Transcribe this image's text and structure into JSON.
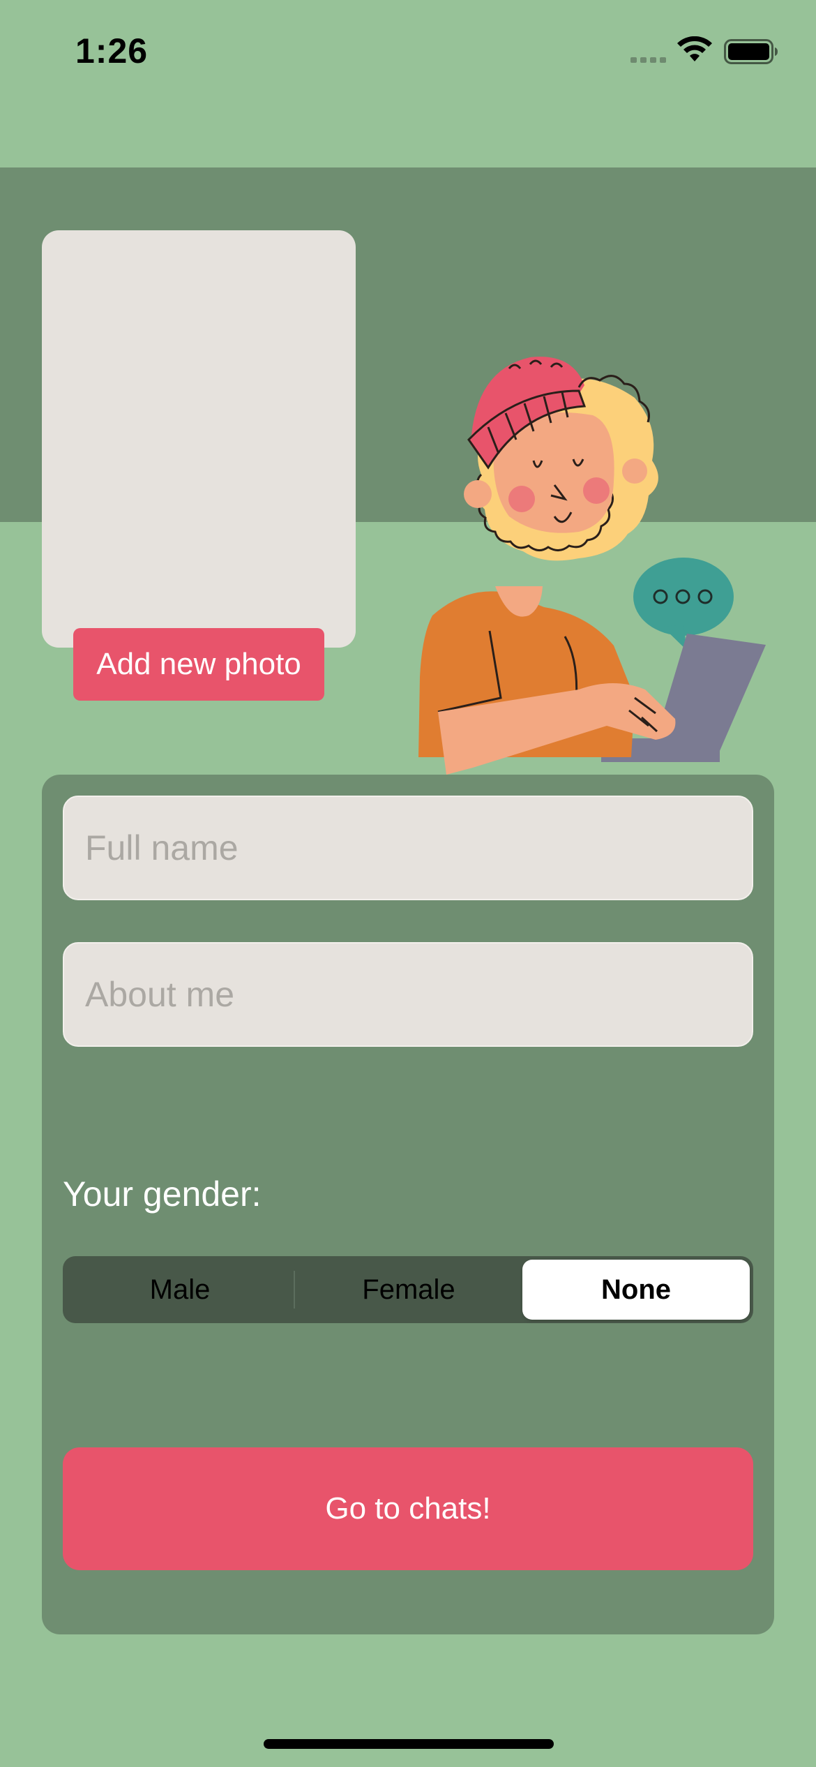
{
  "status_bar": {
    "time": "1:26",
    "icons": [
      "signal-icon",
      "wifi-icon",
      "battery-icon"
    ]
  },
  "profile": {
    "add_photo_label": "Add new photo",
    "illustration": "man-typing-laptop-illustration"
  },
  "form": {
    "full_name": {
      "value": "",
      "placeholder": "Full name"
    },
    "about_me": {
      "value": "",
      "placeholder": "About me"
    },
    "gender_label": "Your gender:",
    "gender_options": [
      "Male",
      "Female",
      "None"
    ],
    "gender_selected": "None",
    "submit_label": "Go to chats!"
  },
  "colors": {
    "background": "#97c298",
    "panel": "#6f8e71",
    "accent": "#e8546b",
    "input_bg": "#e6e2dd",
    "segment_bg": "#485849"
  }
}
